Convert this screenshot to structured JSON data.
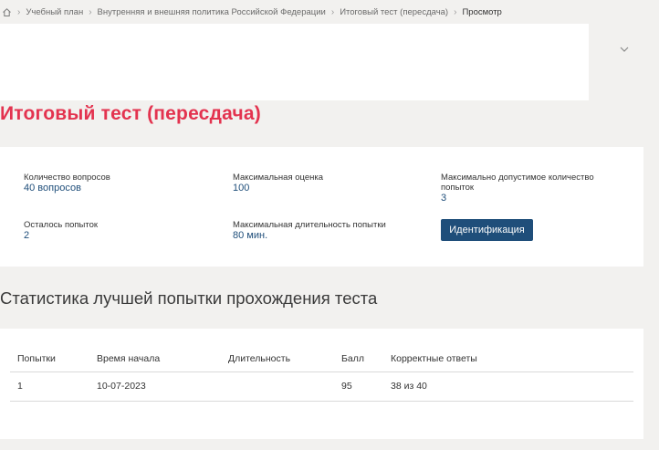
{
  "breadcrumb": {
    "items": [
      "Учебный план",
      "Внутренняя и внешняя политика Российской Федерации",
      "Итоговый тест (пересдача)",
      "Просмотр"
    ]
  },
  "page": {
    "title": "Итоговый тест (пересдача)"
  },
  "info": {
    "questions_label": "Количество вопросов",
    "questions_value": "40 вопросов",
    "max_score_label": "Максимальная оценка",
    "max_score_value": "100",
    "max_attempts_label": "Максимально допустимое количество попыток",
    "max_attempts_value": "3",
    "attempts_left_label": "Осталось попыток",
    "attempts_left_value": "2",
    "max_duration_label": "Максимальная длительность попытки",
    "max_duration_value": "80 мин.",
    "identification_button": "Идентификация"
  },
  "stats": {
    "title": "Статистика лучшей попытки прохождения теста",
    "columns": [
      "Попытки",
      "Время начала",
      "Длительность",
      "Балл",
      "Корректные ответы"
    ],
    "rows": [
      [
        "1",
        "10-07-2023",
        "",
        "95",
        "38 из 40"
      ]
    ]
  },
  "colors": {
    "accent_title": "#e3334f",
    "primary_blue": "#1f4e7a",
    "background": "#f2f1ef"
  }
}
